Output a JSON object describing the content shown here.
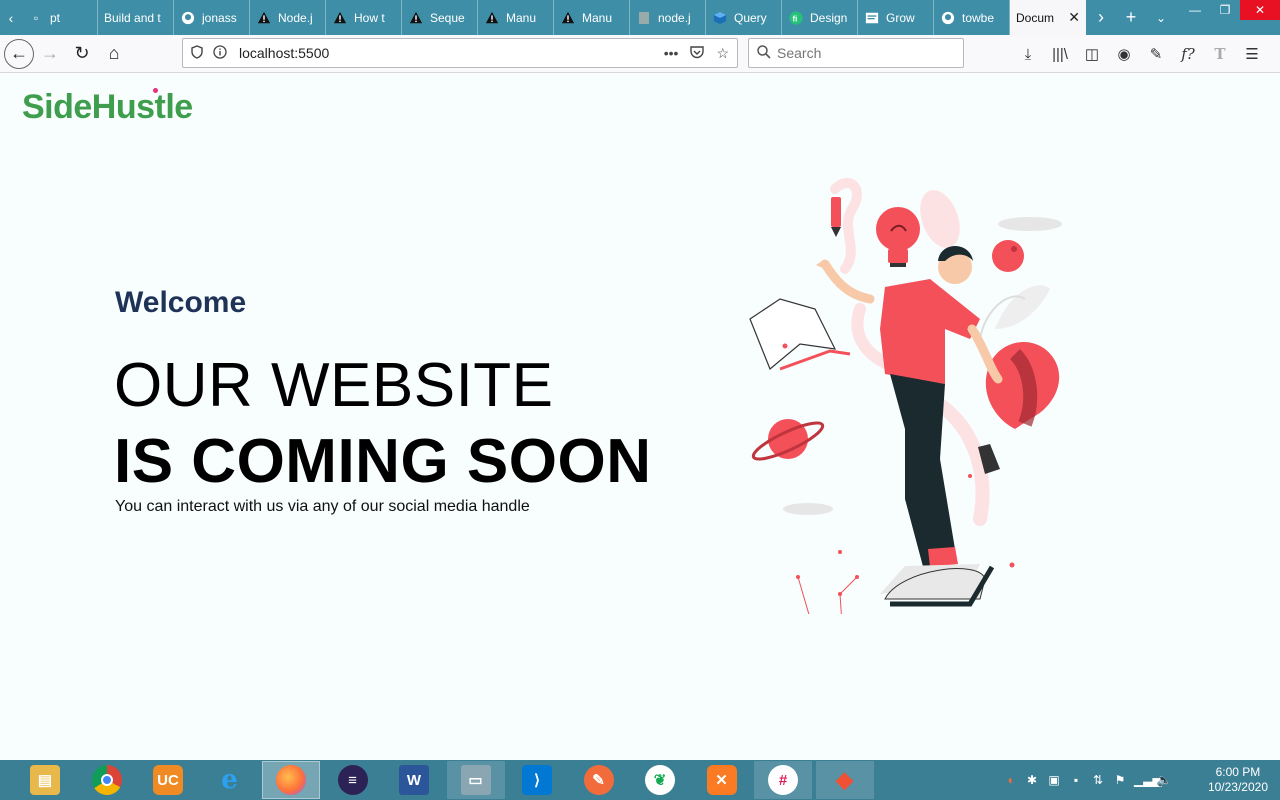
{
  "browser": {
    "tabs": [
      {
        "label": "pt",
        "icon": "doc-icon"
      },
      {
        "label": "Build and t",
        "icon": "none"
      },
      {
        "label": "jonass",
        "icon": "github-icon"
      },
      {
        "label": "Node.j",
        "icon": "warning-icon"
      },
      {
        "label": "How t",
        "icon": "warning-icon"
      },
      {
        "label": "Seque",
        "icon": "warning-icon"
      },
      {
        "label": "Manu",
        "icon": "warning-icon"
      },
      {
        "label": "Manu",
        "icon": "warning-icon"
      },
      {
        "label": "node.j",
        "icon": "page-icon"
      },
      {
        "label": "Query",
        "icon": "cube-icon"
      },
      {
        "label": "Design",
        "icon": "fi-icon"
      },
      {
        "label": "Grow",
        "icon": "doc-icon"
      },
      {
        "label": "towbe",
        "icon": "github-icon"
      },
      {
        "label": "Docum",
        "icon": "none",
        "active": true
      }
    ],
    "url": "localhost:5500",
    "search_placeholder": "Search",
    "colors": {
      "tabstrip": "#3f8ea8",
      "active_tab": "#f7f7f9"
    }
  },
  "page": {
    "logo_text": "SideHustle",
    "welcome": "Welcome",
    "headline_line1": "OUR WEBSITE",
    "headline_line2": "IS COMING SOON",
    "subtext": "You can interact with us via any of our social media handle",
    "colors": {
      "logo": "#3f9e4d",
      "welcome": "#1f3257",
      "accent": "#f4505a"
    }
  },
  "taskbar": {
    "apps": [
      {
        "name": "file-explorer",
        "glyph": "📁",
        "color": "#e8b84a"
      },
      {
        "name": "chrome",
        "glyph": "●",
        "color": "#4285f4"
      },
      {
        "name": "uc-browser",
        "glyph": "UC",
        "color": "#f08a24"
      },
      {
        "name": "internet-explorer",
        "glyph": "e",
        "color": "#1e88e5"
      },
      {
        "name": "firefox",
        "glyph": "●",
        "color": "#ff7139",
        "active": true
      },
      {
        "name": "eclipse",
        "glyph": "≡",
        "color": "#2c2255"
      },
      {
        "name": "word",
        "glyph": "W",
        "color": "#2b579a"
      },
      {
        "name": "monitor",
        "glyph": "▭",
        "color": "#8aa6b3"
      },
      {
        "name": "vs-code",
        "glyph": "⟩",
        "color": "#0078d4"
      },
      {
        "name": "postman",
        "glyph": "✎",
        "color": "#f26b3a"
      },
      {
        "name": "mongodb",
        "glyph": "●",
        "color": "#13aa52"
      },
      {
        "name": "xampp",
        "glyph": "✕",
        "color": "#fb7a24"
      },
      {
        "name": "slack",
        "glyph": "#",
        "color": "#e01e5a"
      },
      {
        "name": "git-gui",
        "glyph": "◆",
        "color": "#f05033"
      }
    ],
    "clock_time": "6:00 PM",
    "clock_date": "10/23/2020"
  }
}
